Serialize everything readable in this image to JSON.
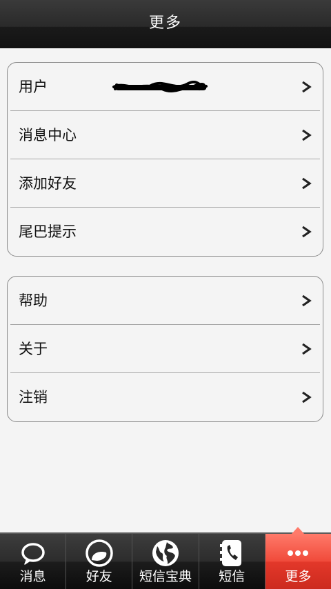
{
  "header": {
    "title": "更多"
  },
  "group1": {
    "items": [
      {
        "label": "用户"
      },
      {
        "label": "消息中心"
      },
      {
        "label": "添加好友"
      },
      {
        "label": "尾巴提示"
      }
    ]
  },
  "group2": {
    "items": [
      {
        "label": "帮助"
      },
      {
        "label": "关于"
      },
      {
        "label": "注销"
      }
    ]
  },
  "tabbar": {
    "tabs": [
      {
        "label": "消息",
        "icon": "speech-bubble-icon"
      },
      {
        "label": "好友",
        "icon": "friend-icon"
      },
      {
        "label": "短信宝典",
        "icon": "globe-icon"
      },
      {
        "label": "短信",
        "icon": "phonebook-icon"
      },
      {
        "label": "更多",
        "icon": "more-dots-icon"
      }
    ],
    "active_index": 4
  },
  "colors": {
    "active_tab": "#e3382a",
    "header_bg": "#1a1a1a",
    "page_bg": "#f4f4f4"
  }
}
